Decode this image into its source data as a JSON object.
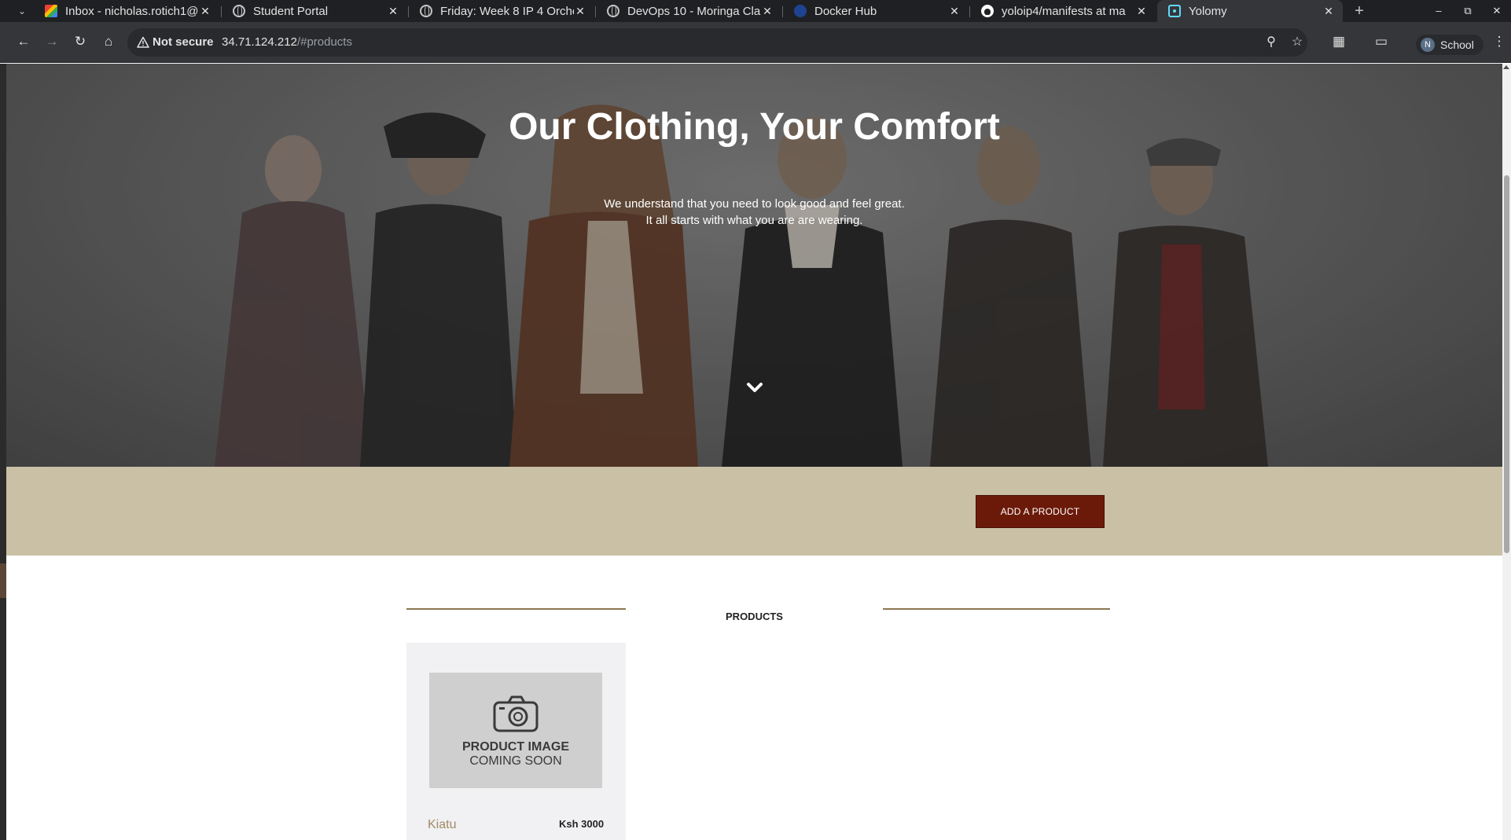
{
  "browser": {
    "tabs": [
      {
        "title": "Inbox - nicholas.rotich1@",
        "icon": "gmail-icon",
        "active": false
      },
      {
        "title": "Student Portal",
        "icon": "globe-icon",
        "active": false
      },
      {
        "title": "Friday: Week 8 IP 4 Orche",
        "icon": "globe-icon",
        "active": false
      },
      {
        "title": "DevOps 10 - Moringa Cla",
        "icon": "moringa-icon",
        "active": false
      },
      {
        "title": "Docker Hub",
        "icon": "docker-icon",
        "active": false
      },
      {
        "title": "yoloip4/manifests at ma",
        "icon": "github-icon",
        "active": false
      },
      {
        "title": "Yolomy",
        "icon": "react-icon",
        "active": true
      }
    ],
    "new_tab_glyph": "+",
    "address": {
      "security_label": "Not secure",
      "host": "34.71.124.212",
      "path": "/#products"
    },
    "profile": {
      "initial": "N",
      "name": "School"
    }
  },
  "hero": {
    "title": "Our Clothing, Your Comfort",
    "subtitle_line1": "We understand that you need to look good and feel great.",
    "subtitle_line2": "It all starts with what you are are wearing."
  },
  "action_band": {
    "add_product_label": "ADD A PRODUCT",
    "color": "#c9c0a6",
    "button_color": "#6b1a0a"
  },
  "products_section": {
    "heading": "PRODUCTS",
    "items": [
      {
        "image_text_line1": "PRODUCT IMAGE",
        "image_text_line2": "COMING SOON",
        "name": "Kiatu",
        "price": "Ksh 3000"
      }
    ]
  }
}
